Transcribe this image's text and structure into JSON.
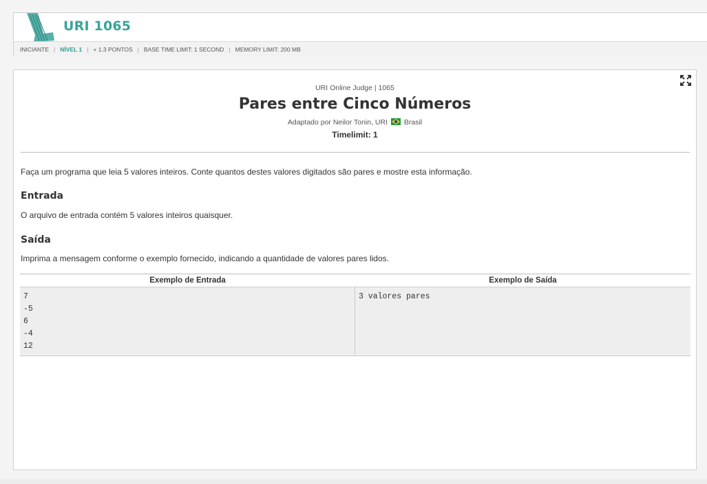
{
  "header": {
    "problem_code": "URI 1065",
    "info": {
      "category": "INICIANTE",
      "level": "NÍVEL 1",
      "points": "+ 1.3 PONTOS",
      "time_limit": "BASE TIME LIMIT: 1 SECOND",
      "memory_limit": "MEMORY LIMIT: 200 MB"
    }
  },
  "problem": {
    "judge_line": "URI Online Judge | 1065",
    "title": "Pares entre Cinco Números",
    "author_prefix": "Adaptado por Neilor Tonin, URI",
    "author_country": "Brasil",
    "timelimit": "Timelimit: 1",
    "description": "Faça um programa que leia 5 valores inteiros. Conte quantos destes valores digitados são pares e mostre esta informação.",
    "input_heading": "Entrada",
    "input_text": "O arquivo de entrada contém 5 valores inteiros quaisquer.",
    "output_heading": "Saída",
    "output_text": "Imprima a mensagem conforme o exemplo fornecido, indicando a quantidade de valores pares lidos."
  },
  "examples": {
    "input_header": "Exemplo de Entrada",
    "output_header": "Exemplo de Saída",
    "input_lines": [
      "7",
      "-5",
      "6",
      "-4",
      "12"
    ],
    "output_lines": [
      "3 valores pares"
    ]
  },
  "colors": {
    "accent": "#3aa39a",
    "level": "#2a9d8f"
  },
  "icons": {
    "logo": "uri-logo-icon",
    "fullscreen": "fullscreen-icon",
    "flag": "brazil-flag-icon"
  }
}
